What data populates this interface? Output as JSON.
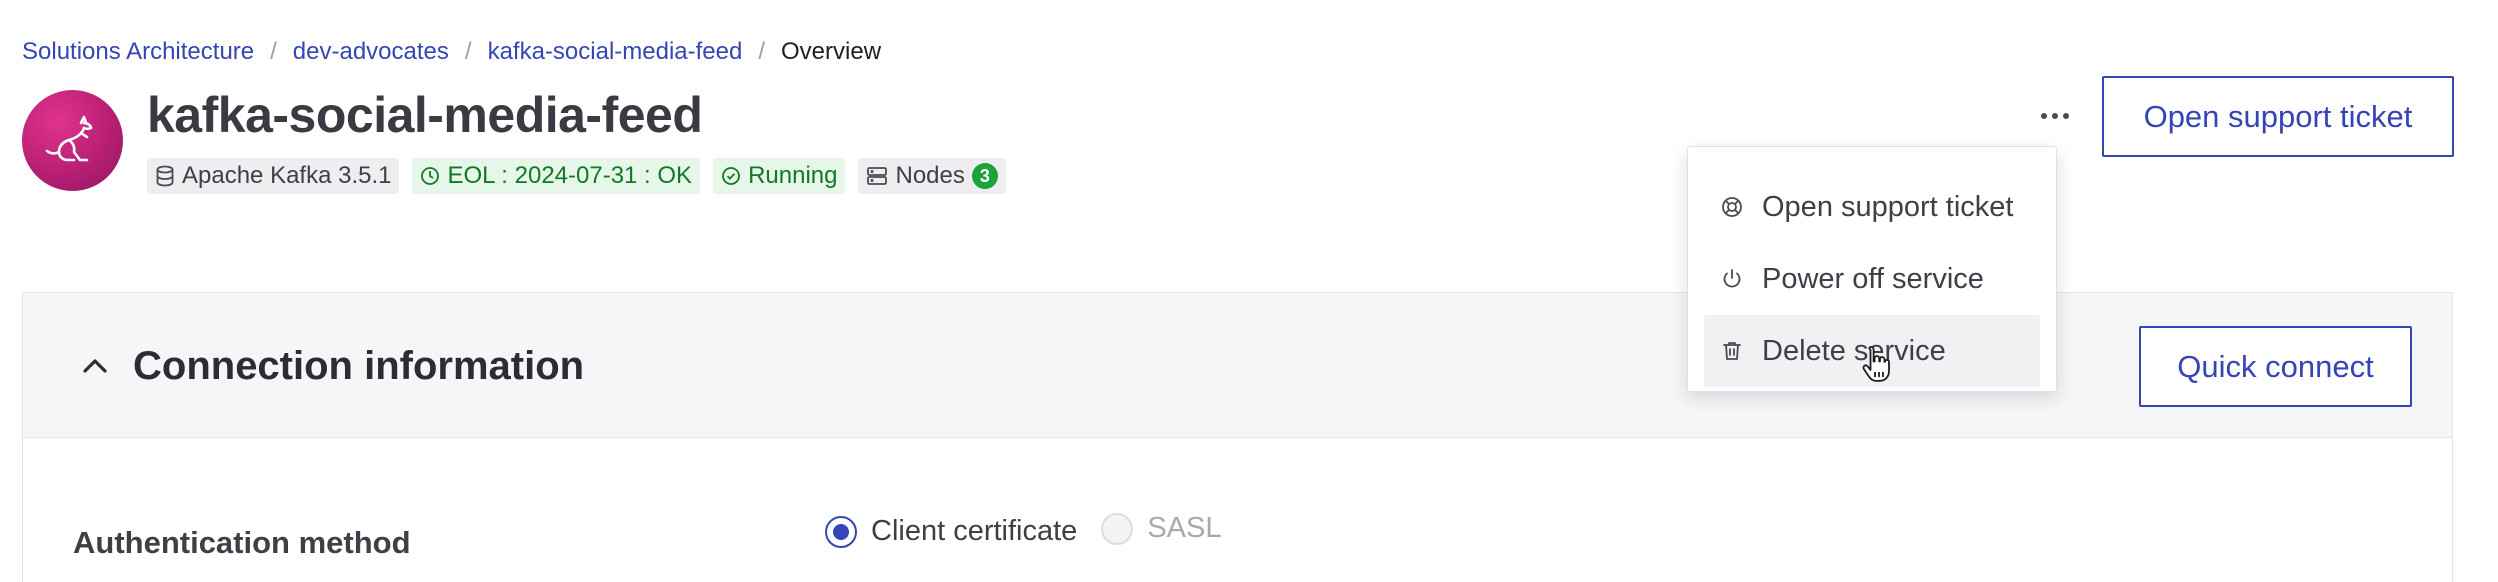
{
  "breadcrumb": {
    "items": [
      "Solutions Architecture",
      "dev-advocates",
      "kafka-social-media-feed"
    ],
    "current": "Overview",
    "separator": "/"
  },
  "service": {
    "title": "kafka-social-media-feed",
    "avatar_icon": "kangaroo-icon",
    "badges": {
      "version": "Apache Kafka 3.5.1",
      "eol": "EOL : 2024-07-31 : OK",
      "status": "Running",
      "nodes_label": "Nodes",
      "nodes_count": "3"
    }
  },
  "header_actions": {
    "more_icon": "more-horizontal-icon",
    "support_button": "Open support ticket"
  },
  "menu": {
    "items": [
      {
        "label": "Open support ticket",
        "icon": "lifebuoy-icon"
      },
      {
        "label": "Power off service",
        "icon": "power-icon"
      },
      {
        "label": "Delete service",
        "icon": "trash-icon"
      }
    ]
  },
  "connection": {
    "title": "Connection information",
    "quick_connect": "Quick connect",
    "auth_label": "Authentication method",
    "auth_options": [
      {
        "label": "Client certificate",
        "selected": true
      },
      {
        "label": "SASL",
        "selected": false,
        "disabled": true
      }
    ]
  },
  "colors": {
    "accent": "#3545b5",
    "success": "#117a26",
    "avatar": "#c2227a"
  }
}
